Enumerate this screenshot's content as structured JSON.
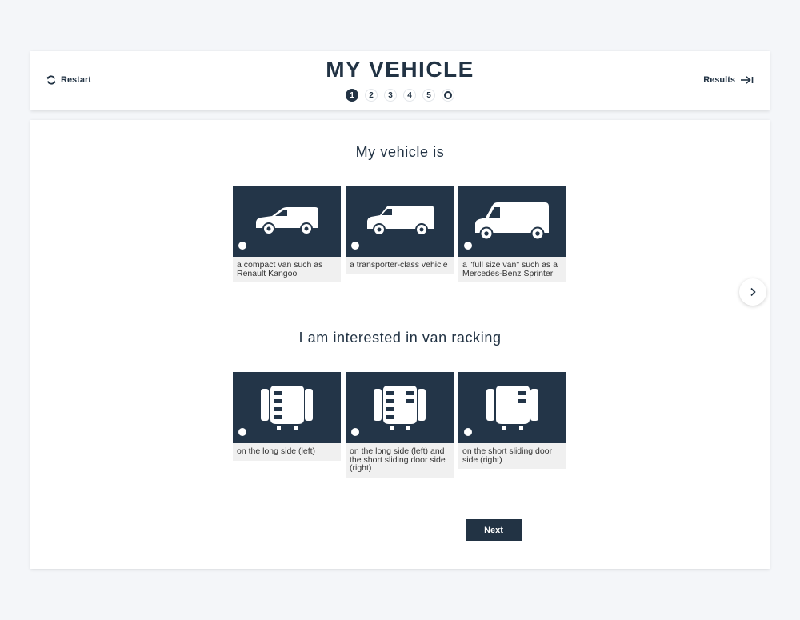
{
  "header": {
    "title": "MY VEHICLE",
    "restart_label": "Restart",
    "results_label": "Results",
    "steps": [
      "1",
      "2",
      "3",
      "4",
      "5"
    ],
    "active_step": 1
  },
  "question1": {
    "title": "My vehicle is",
    "options": [
      {
        "label": "a compact van such as Renault Kangoo",
        "icon": "compact-van-icon"
      },
      {
        "label": "a transporter-class vehicle",
        "icon": "transporter-van-icon"
      },
      {
        "label": "a \"full size van\" such as a Mercedes-Benz Sprinter",
        "icon": "full-size-van-icon"
      }
    ]
  },
  "question2": {
    "title": "I am interested in van racking",
    "options": [
      {
        "label": "on the long side (left)",
        "icon": "racking-left-icon"
      },
      {
        "label": "on the long side (left) and the short sliding door side (right)",
        "icon": "racking-both-icon"
      },
      {
        "label": "on the short sliding door side (right)",
        "icon": "racking-right-icon"
      }
    ]
  },
  "next_label": "Next",
  "colors": {
    "primary": "#223344",
    "tile": "#233548",
    "caption_bg": "#f0f0f0",
    "page_bg": "#f4f6f9"
  }
}
